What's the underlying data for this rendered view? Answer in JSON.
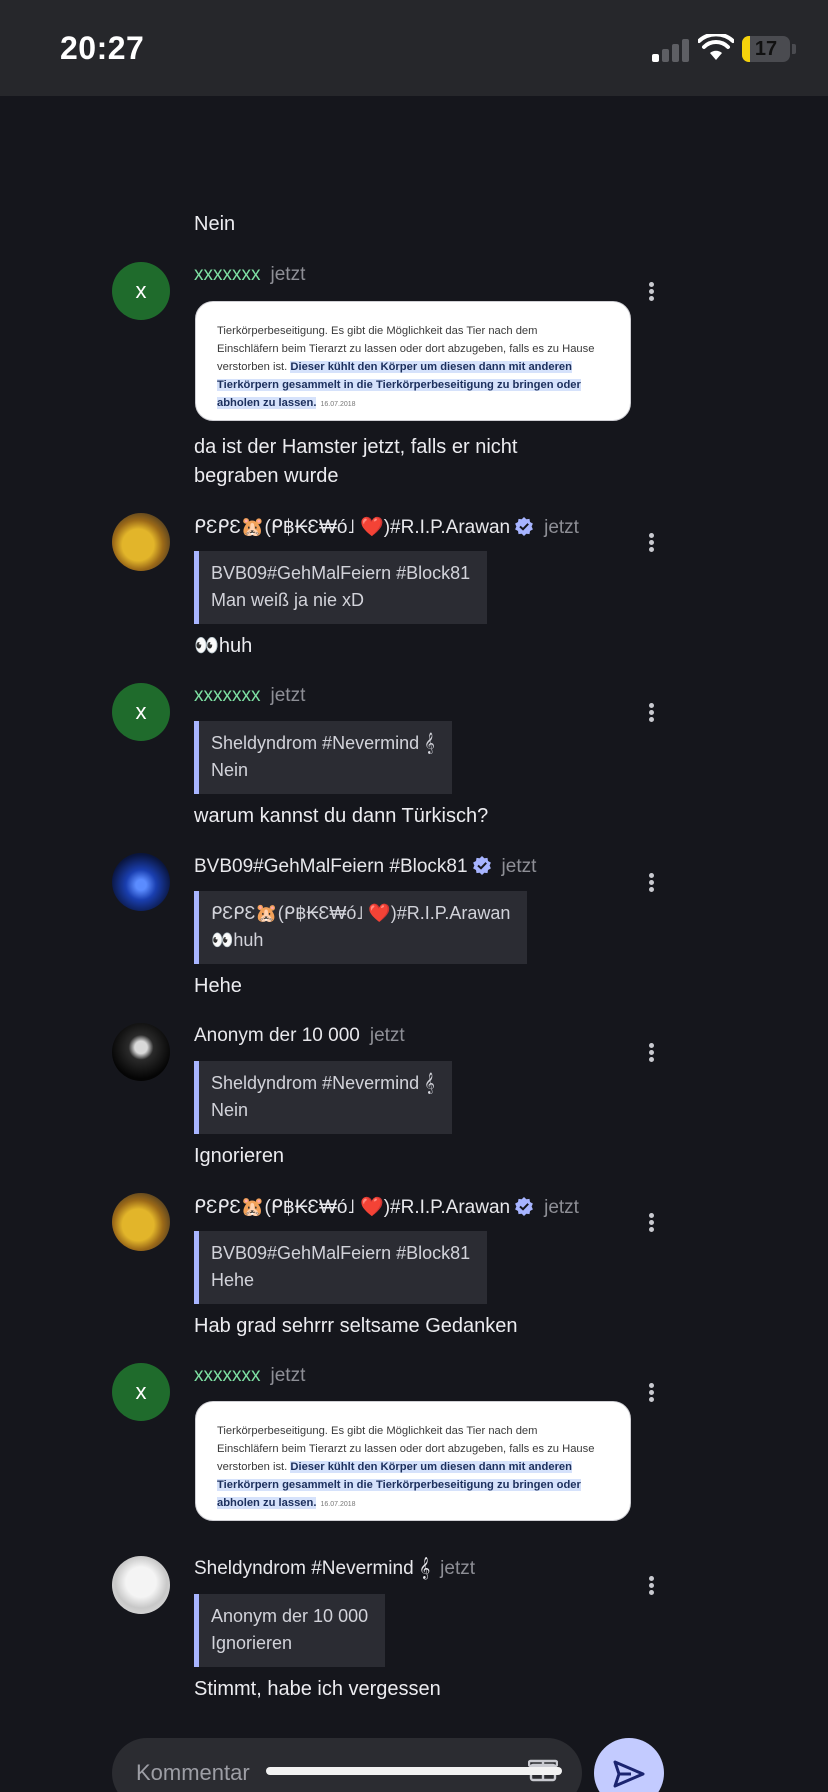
{
  "status_bar": {
    "time": "20:27",
    "battery": "17",
    "battery_level_percent": 17
  },
  "messages": [
    {
      "text": "Nein"
    },
    {
      "author": "xxxxxxx",
      "author_color": "#7ee0a3",
      "timestamp": "jetzt",
      "avatar_initial": "x",
      "image": {
        "text_plain": "Tierkörperbeseitigung. Es gibt die Möglichkeit das Tier nach dem Einschläfern beim Tierarzt zu lassen oder dort abzugeben, falls es zu Hause verstorben ist. ",
        "text_highlight": "Dieser kühlt den Körper um diesen dann mit anderen Tierkörpern gesammelt in die Tierkörperbeseitigung zu bringen oder abholen zu lassen.",
        "date": "16.07.2018"
      },
      "text": "da ist der Hamster jetzt, falls er nicht begraben wurde"
    },
    {
      "author": "ᑭƐᑭƐ🐹(ᑭ฿₭Ɛ₩ó˩ ❤️)#R.I.P.Arawan",
      "verified": true,
      "timestamp": "jetzt",
      "quote": {
        "author": "BVB09#GehMalFeiern #Block81",
        "text": "Man weiß ja nie xD"
      },
      "text": "👀huh"
    },
    {
      "author": "xxxxxxx",
      "author_color": "#7ee0a3",
      "timestamp": "jetzt",
      "avatar_initial": "x",
      "quote": {
        "author": "Sheldyndrom #Nevermind 𝄞",
        "text": "Nein"
      },
      "text": "warum kannst du dann Türkisch?"
    },
    {
      "author": "BVB09#GehMalFeiern #Block81",
      "verified": true,
      "timestamp": "jetzt",
      "quote": {
        "author": "ᑭƐᑭƐ🐹(ᑭ฿₭Ɛ₩ó˩ ❤️)#R.I.P.Arawan",
        "text": "👀huh"
      },
      "text": "Hehe"
    },
    {
      "author": "Anonym der 10 000",
      "timestamp": "jetzt",
      "quote": {
        "author": "Sheldyndrom #Nevermind 𝄞",
        "text": "Nein"
      },
      "text": "Ignorieren"
    },
    {
      "author": "ᑭƐᑭƐ🐹(ᑭ฿₭Ɛ₩ó˩ ❤️)#R.I.P.Arawan",
      "verified": true,
      "timestamp": "jetzt",
      "quote": {
        "author": "BVB09#GehMalFeiern #Block81",
        "text": "Hehe"
      },
      "text": "Hab grad sehrrr seltsame Gedanken"
    },
    {
      "author": "xxxxxxx",
      "author_color": "#7ee0a3",
      "timestamp": "jetzt",
      "avatar_initial": "x",
      "image": {
        "text_plain": "Tierkörperbeseitigung. Es gibt die Möglichkeit das Tier nach dem Einschläfern beim Tierarzt zu lassen oder dort abzugeben, falls es zu Hause verstorben ist. ",
        "text_highlight": "Dieser kühlt den Körper um diesen dann mit anderen Tierkörpern gesammelt in die Tierkörperbeseitigung zu bringen oder abholen zu lassen.",
        "date": "16.07.2018"
      }
    },
    {
      "author": "Sheldyndrom #Nevermind 𝄞",
      "timestamp": "jetzt",
      "quote": {
        "author": "Anonym der 10 000",
        "text": "Ignorieren"
      },
      "text": "Stimmt, habe ich vergessen"
    }
  ],
  "composer": {
    "placeholder": "Kommentar"
  },
  "colors": {
    "background": "#15161c",
    "quote_accent": "#a7b4ff",
    "send_button": "#c3cbff",
    "verified": "#a7b4ff"
  },
  "icons": {
    "send": "send-icon",
    "gift": "gift-icon",
    "more": "more-vertical-icon",
    "verified": "verified-badge-icon"
  }
}
